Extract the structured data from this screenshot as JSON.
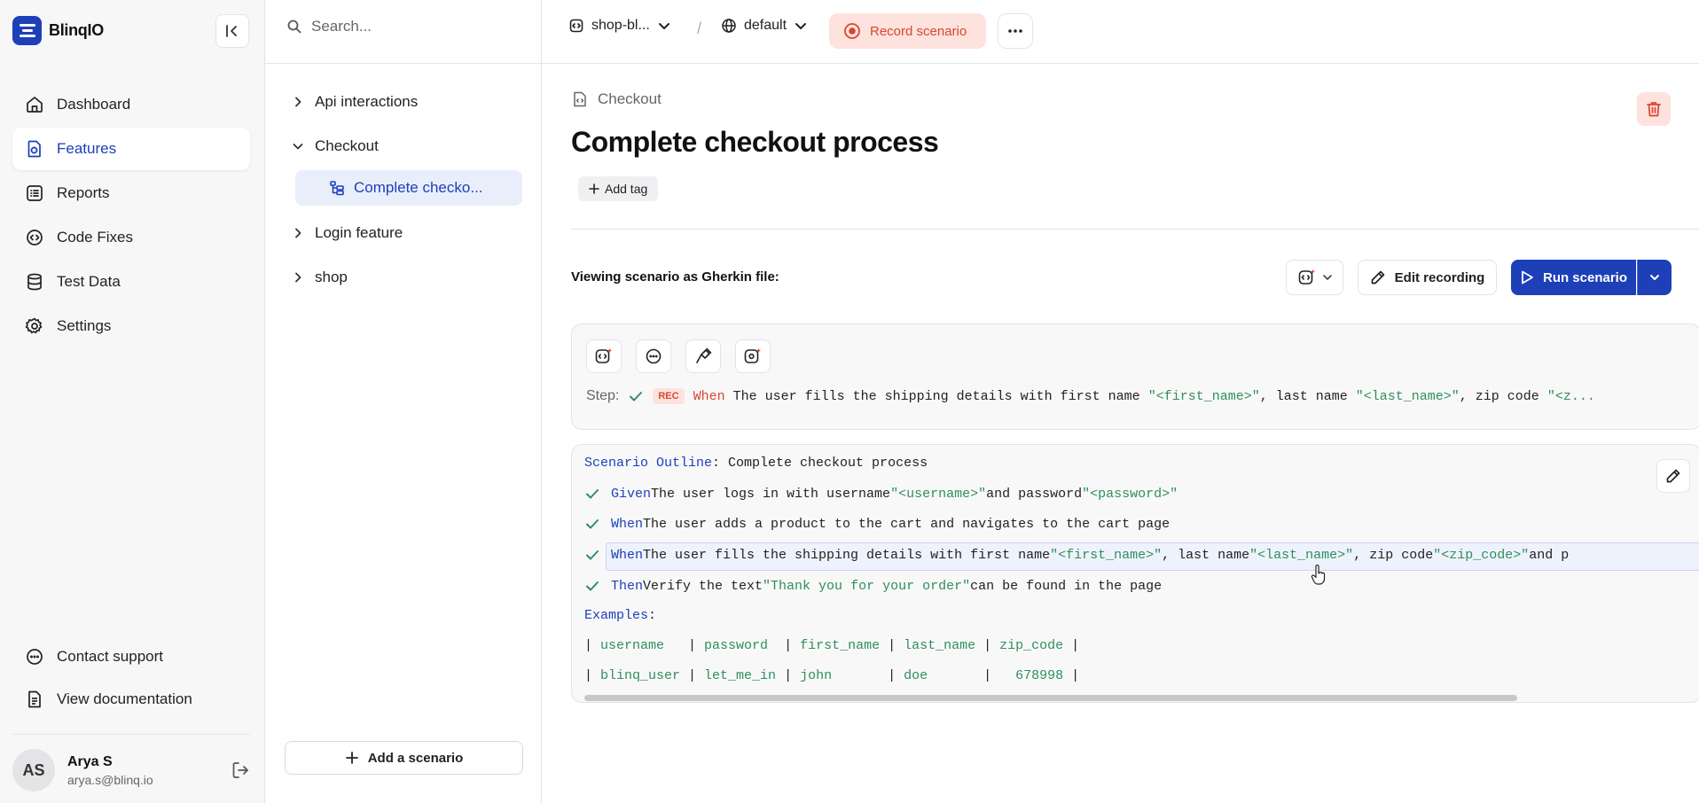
{
  "brand": {
    "name": "BlinqIO",
    "color": "#1d3fb8"
  },
  "sidebar": {
    "items": [
      {
        "label": "Dashboard",
        "icon": "home-icon"
      },
      {
        "label": "Features",
        "icon": "feature-icon",
        "active": true
      },
      {
        "label": "Reports",
        "icon": "list-icon"
      },
      {
        "label": "Code Fixes",
        "icon": "code-gear-icon"
      },
      {
        "label": "Test Data",
        "icon": "database-icon"
      },
      {
        "label": "Settings",
        "icon": "gear-icon"
      }
    ],
    "bottom": [
      {
        "label": "Contact support",
        "icon": "chat-icon"
      },
      {
        "label": "View documentation",
        "icon": "document-icon"
      }
    ],
    "user": {
      "initials": "AS",
      "name": "Arya S",
      "email": "arya.s@blinq.io"
    }
  },
  "tree": {
    "search_placeholder": "Search...",
    "items": [
      {
        "label": "Api interactions",
        "expanded": false
      },
      {
        "label": "Checkout",
        "expanded": true,
        "children": [
          {
            "label": "Complete checko...",
            "selected": true
          }
        ]
      },
      {
        "label": "Login feature",
        "expanded": false
      },
      {
        "label": "shop",
        "expanded": false
      }
    ],
    "add_scenario_label": "Add a scenario"
  },
  "topbar": {
    "project": "shop-bl...",
    "separator": "/",
    "environment": "default",
    "record_label": "Record scenario"
  },
  "main": {
    "breadcrumb": "Checkout",
    "title": "Complete checkout process",
    "add_tag_label": "Add tag",
    "viewing_label": "Viewing scenario as Gherkin file:",
    "edit_recording_label": "Edit recording",
    "run_label": "Run scenario",
    "step": {
      "label": "Step:",
      "badge": "REC",
      "keyword": "When",
      "text_before": " The user fills the shipping details with first name ",
      "s1": "\"<first_name>\"",
      "t2": ", last name ",
      "s2": "\"<last_name>\"",
      "t3": ", zip code ",
      "s3": "\"<z..."
    },
    "code": {
      "outline_kw": "Scenario Outline",
      "outline_rest": ": Complete checkout process",
      "lines": [
        {
          "kw": "Given",
          "a": " The user logs in with username ",
          "s1": "\"<username>\"",
          "b": " and password ",
          "s2": "\"<password>\"",
          "c": ""
        },
        {
          "kw": "When",
          "a": " The user adds a product to the cart and navigates to the cart page",
          "s1": "",
          "b": "",
          "s2": "",
          "c": ""
        },
        {
          "kw": "When",
          "a": " The user fills the shipping details with first name ",
          "s1": "\"<first_name>\"",
          "b": ", last name ",
          "s2": "\"<last_name>\"",
          "c": ", zip code ",
          "s3": "\"<zip_code>\"",
          "d": " and p"
        },
        {
          "kw": "Then",
          "a": " Verify the text ",
          "s1": "\"Thank you for your order\"",
          "b": " can be found in the page",
          "s2": "",
          "c": ""
        }
      ],
      "examples_kw": "Examples",
      "examples_colon": ":",
      "table_header": [
        "username  ",
        "password ",
        "first_name",
        "last_name",
        "zip_code"
      ],
      "table_row": [
        "blinq_user",
        "let_me_in",
        "john      ",
        "doe      ",
        "  678998"
      ]
    }
  },
  "colors": {
    "accent": "#1d3fb8",
    "record": "#d8472f",
    "success": "#2f8f5b"
  }
}
